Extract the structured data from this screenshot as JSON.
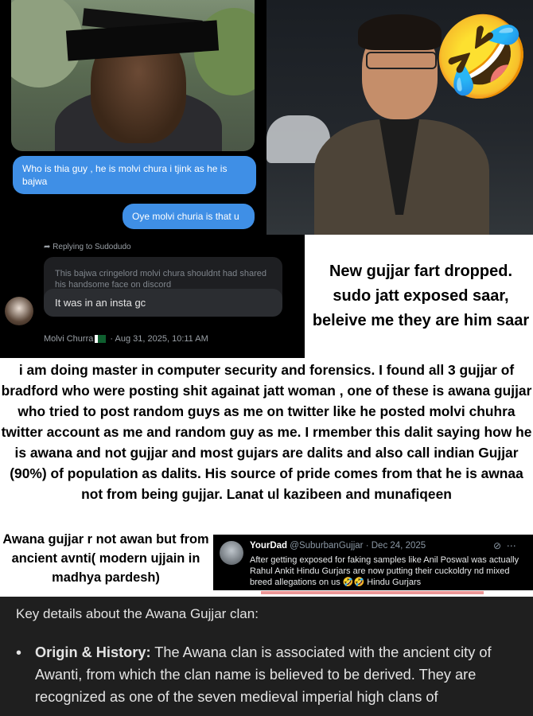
{
  "chat": {
    "message_1": "Who is thia guy , he is molvi chura i tjink as he is bajwa",
    "message_2": "Oye molvi churia is that u"
  },
  "emoji": "🤣",
  "discord": {
    "replying_to": "Replying to Sudodudo",
    "quoted_message": "This bajwa cringelord molvi chura shouldnt  had shared his handsome face on discord",
    "reply_message": "It was in an insta gc",
    "author": "Molvi Churra",
    "timestamp": "Aug 31, 2025, 10:11 AM"
  },
  "captions": {
    "right": "New gujjar fart dropped. sudo jatt exposed saar, beleive me they are him saar",
    "main": "i am doing master in computer security and forensics. I found all 3 gujjar of bradford who were posting shit againat jatt woman , one of these is awana gujjar who tried to post random guys as me on twitter like he posted molvi chuhra twitter account as me and random guy as me. I rmember this dalit saying how he is awana and not gujjar and most gujars are dalits and also call indian Gujjar (90%) of population as dalits. His source of pride comes from that he is awnaa not from being gujjar. Lanat ul kazibeen and munafiqeen",
    "awana": "Awana gujjar r not awan but from ancient avnti( modern ujjain in madhya pardesh)"
  },
  "tweet": {
    "display_name": "YourDad",
    "handle": "@SuburbanGujjar",
    "date": "Dec 24, 2025",
    "body": "After getting exposed for faking samples like Anil Poswal was actually Rahul Ankit Hindu Gurjars are now putting their cuckoldry nd mixed breed allegations on us 🤣🤣 Hindu Gurjars"
  },
  "details": {
    "heading": "Key details about the Awana Gujjar clan:",
    "bullet_title": "Origin & History:",
    "bullet_text": "The Awana clan is associated with the ancient city of Awanti, from which the clan name is believed to be derived. They are recognized as one of the seven medieval imperial high clans of"
  }
}
